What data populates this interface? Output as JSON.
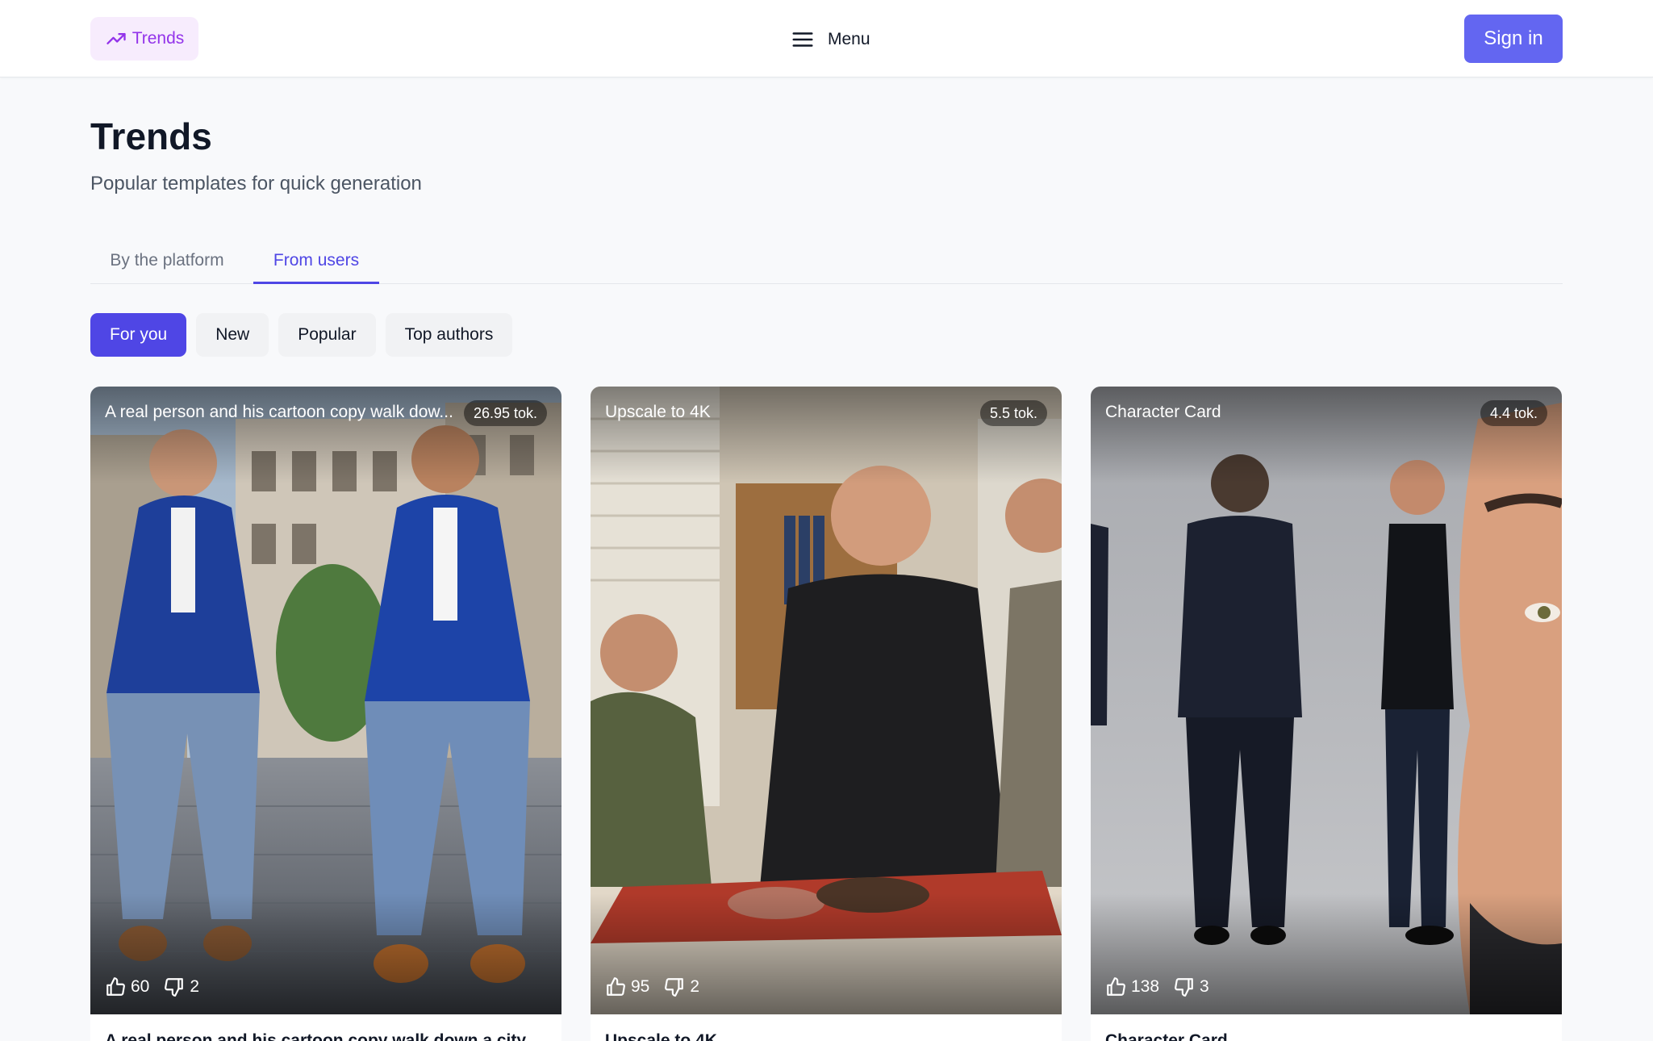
{
  "header": {
    "trends_label": "Trends",
    "menu_label": "Menu",
    "signin_label": "Sign in"
  },
  "page": {
    "title": "Trends",
    "subtitle": "Popular templates for quick generation"
  },
  "tabs": [
    {
      "label": "By the platform",
      "active": false
    },
    {
      "label": "From users",
      "active": true
    }
  ],
  "filters": [
    {
      "label": "For you",
      "active": true
    },
    {
      "label": "New",
      "active": false
    },
    {
      "label": "Popular",
      "active": false
    },
    {
      "label": "Top authors",
      "active": false
    }
  ],
  "cards": [
    {
      "overlay_title": "A real person and his cartoon copy walk dow...",
      "tokens": "26.95 tok.",
      "likes": "60",
      "dislikes": "2",
      "caption": "A real person and his cartoon copy walk down a city"
    },
    {
      "overlay_title": "Upscale to 4K",
      "tokens": "5.5 tok.",
      "likes": "95",
      "dislikes": "2",
      "caption": "Upscale to 4K"
    },
    {
      "overlay_title": "Character Card",
      "tokens": "4.4 tok.",
      "likes": "138",
      "dislikes": "3",
      "caption": "Character Card"
    }
  ],
  "colors": {
    "accent": "#4f46e5",
    "signin": "#6366f1",
    "trends_pill_bg": "#f7ecfd",
    "trends_pill_text": "#9333ea"
  }
}
